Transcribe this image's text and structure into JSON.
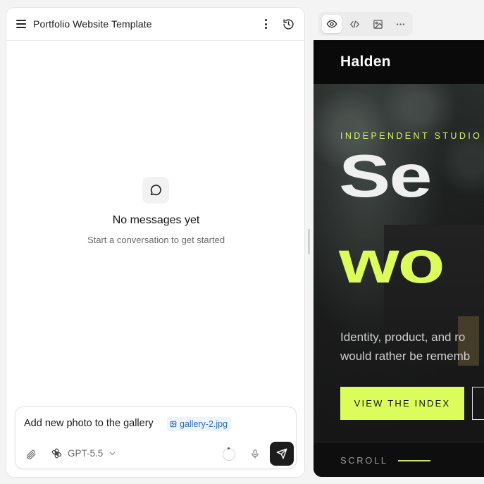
{
  "chat_panel": {
    "project_title": "Portfolio Website Template",
    "empty_state": {
      "title": "No messages yet",
      "subtitle": "Start a conversation to get started"
    },
    "composer": {
      "message_text": "Add new photo to the gallery",
      "attachment_name": "gallery-2.jpg",
      "model_label": "GPT-5.5"
    }
  },
  "preview_panel": {
    "toolbar": {
      "active_tab": "preview"
    },
    "site": {
      "brand": "Halden",
      "eyebrow": "INDEPENDENT STUDIO",
      "headline_line1": "Se",
      "headline_line2": "wo",
      "description_line1": "Identity, product, and ro",
      "description_line2": "would rather be rememb",
      "cta_primary": "VIEW THE INDEX",
      "scroll_label": "SCROLL"
    },
    "colors": {
      "accent": "#dcfc5b",
      "background": "#0e0e0e"
    }
  }
}
